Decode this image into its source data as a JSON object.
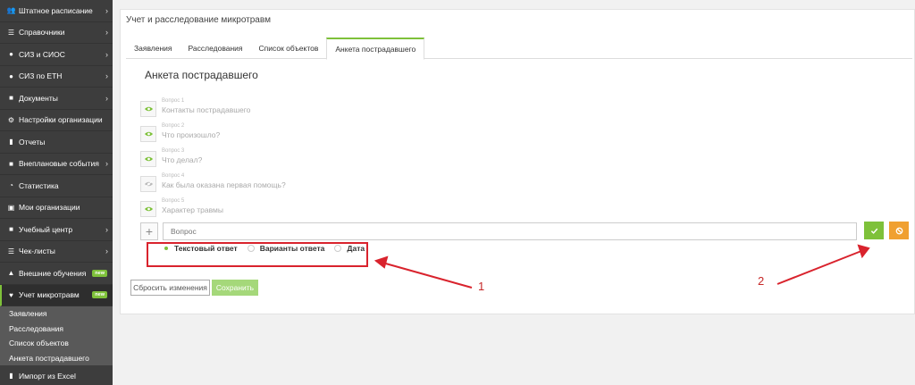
{
  "sidebar": {
    "items": [
      {
        "label": "Штатное расписание",
        "icon": "users-icon",
        "chevron": true,
        "badge": ""
      },
      {
        "label": "Справочники",
        "icon": "list-icon",
        "chevron": true,
        "badge": ""
      },
      {
        "label": "СИЗ и СИОС",
        "icon": "group-icon",
        "chevron": true,
        "badge": ""
      },
      {
        "label": "СИЗ по ЕТН",
        "icon": "group-icon",
        "chevron": true,
        "badge": ""
      },
      {
        "label": "Документы",
        "icon": "folder-icon",
        "chevron": true,
        "badge": ""
      },
      {
        "label": "Настройки организации",
        "icon": "gear-icon",
        "chevron": false,
        "badge": ""
      },
      {
        "label": "Отчеты",
        "icon": "file-icon",
        "chevron": false,
        "badge": ""
      },
      {
        "label": "Внеплановые события",
        "icon": "folder-icon",
        "chevron": true,
        "badge": ""
      },
      {
        "label": "Статистика",
        "icon": "pie-chart-icon",
        "chevron": false,
        "badge": ""
      },
      {
        "label": "Мои организации",
        "icon": "briefcase-icon",
        "chevron": false,
        "badge": ""
      },
      {
        "label": "Учебный центр",
        "icon": "folder-icon",
        "chevron": true,
        "badge": ""
      },
      {
        "label": "Чек-листы",
        "icon": "list-icon",
        "chevron": true,
        "badge": ""
      },
      {
        "label": "Внешние обучения",
        "icon": "graduation-cap-icon",
        "chevron": false,
        "badge": "new"
      },
      {
        "label": "Учет микротравм",
        "icon": "heart-icon",
        "chevron": false,
        "badge": "new"
      }
    ],
    "subitems": [
      {
        "label": "Заявления"
      },
      {
        "label": "Расследования"
      },
      {
        "label": "Список объектов"
      },
      {
        "label": "Анкета пострадавшего"
      }
    ],
    "bottom_item": {
      "label": "Импорт из Excel",
      "icon": "file-icon"
    }
  },
  "panel": {
    "title": "Учет и расследование микротравм",
    "tabs": [
      {
        "label": "Заявления"
      },
      {
        "label": "Расследования"
      },
      {
        "label": "Список объектов"
      },
      {
        "label": "Анкета пострадавшего"
      }
    ],
    "form_title": "Анкета пострадавшего",
    "questions": [
      {
        "num": "Вопрос 1",
        "text": "Контакты пострадавшего",
        "visible": true
      },
      {
        "num": "Вопрос 2",
        "text": "Что произошло?",
        "visible": true
      },
      {
        "num": "Вопрос 3",
        "text": "Что делал?",
        "visible": true
      },
      {
        "num": "Вопрос 4",
        "text": "Как была оказана первая помощь?",
        "visible": false
      },
      {
        "num": "Вопрос 5",
        "text": "Характер травмы",
        "visible": true
      }
    ],
    "new_question": {
      "placeholder": "Вопрос",
      "value": ""
    },
    "answer_types": [
      {
        "label": "Текстовый ответ",
        "selected": true
      },
      {
        "label": "Варианты ответа",
        "selected": false
      },
      {
        "label": "Дата",
        "selected": false
      }
    ],
    "reset_label": "Сбросить изменения",
    "save_label": "Сохранить"
  },
  "annotations": {
    "label1": "1",
    "label2": "2",
    "color": "#d9232d"
  },
  "colors": {
    "accent": "#7ec13a",
    "warning": "#f0a030",
    "sidebar": "#3d3d3d"
  }
}
